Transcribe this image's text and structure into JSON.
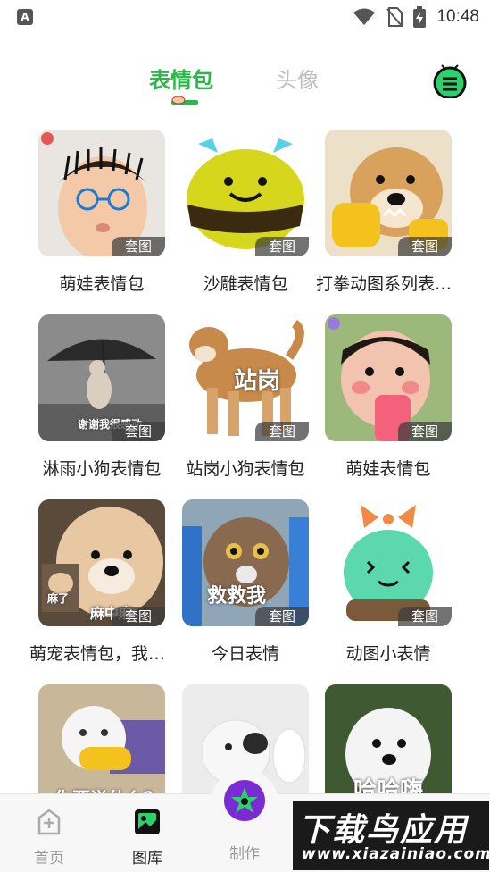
{
  "status_bar": {
    "time": "10:48",
    "app_icon_letter": "A"
  },
  "header": {
    "tabs": [
      {
        "label": "表情包",
        "active": true
      },
      {
        "label": "头像",
        "active": false
      }
    ],
    "accent_color": "#2bb84a"
  },
  "grid": {
    "badge_label": "套图",
    "cards": [
      {
        "title": "萌娃表情包",
        "overlay": ""
      },
      {
        "title": "沙雕表情包",
        "overlay": ""
      },
      {
        "title": "打拳动图系列表情包",
        "overlay": ""
      },
      {
        "title": "淋雨小狗表情包",
        "overlay": "谢谢我很感动"
      },
      {
        "title": "站岗小狗表情包",
        "overlay": "站岗"
      },
      {
        "title": "萌娃表情包",
        "overlay": ""
      },
      {
        "title": "萌宠表情包，我麻了",
        "overlay": "麻中麻",
        "overlay2": "麻了"
      },
      {
        "title": "今日表情",
        "overlay": "救救我"
      },
      {
        "title": "动图小表情",
        "overlay": ""
      },
      {
        "title": "",
        "overlay": "你要说什么？"
      },
      {
        "title": "",
        "overlay": ""
      },
      {
        "title": "",
        "overlay": "哈哈嗨"
      }
    ]
  },
  "bottom_nav": {
    "items": [
      {
        "label": "首页",
        "active": false
      },
      {
        "label": "图库",
        "active": true
      },
      {
        "label": "制作",
        "active": false
      }
    ]
  },
  "watermark": {
    "title": "下载鸟应用",
    "url": "www.xiazainiao.com"
  }
}
